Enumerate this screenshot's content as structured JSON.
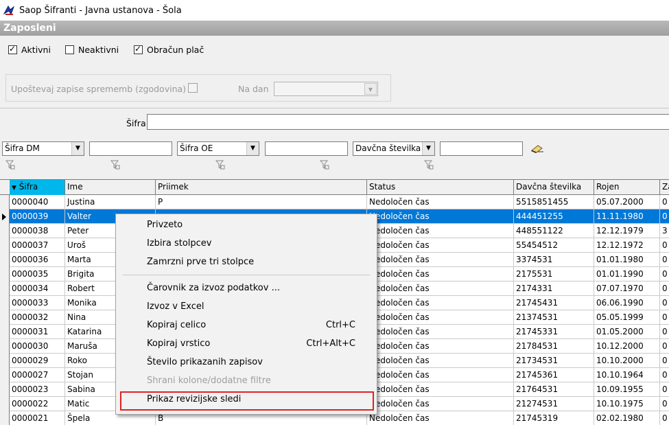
{
  "window": {
    "title": "Saop Šifranti - Javna ustanova - Šola"
  },
  "section": {
    "title": "Zaposleni"
  },
  "filters": {
    "aktivni": {
      "label": "Aktivni",
      "checked": true
    },
    "neaktivni": {
      "label": "Neaktivni",
      "checked": false
    },
    "obracun": {
      "label": "Obračun plač",
      "checked": true
    }
  },
  "history": {
    "label": "Upoštevaj zapise sprememb (zgodovina)",
    "date_label": "Na dan",
    "date_value": ""
  },
  "search": {
    "label": "Šifra",
    "value": ""
  },
  "column_filters": [
    {
      "field": "Šifra DM",
      "value": ""
    },
    {
      "field": "Šifra OE",
      "value": ""
    },
    {
      "field": "Davčna številka",
      "value": ""
    }
  ],
  "table": {
    "columns": [
      "Šifra",
      "Ime",
      "Priimek",
      "Status",
      "Davčna številka",
      "Rojen",
      "Za"
    ],
    "rows": [
      [
        "0000040",
        "Justina",
        "P",
        "Nedoločen čas",
        "5515851455",
        "05.07.2000",
        "0"
      ],
      [
        "0000039",
        "Valter",
        "",
        "Nedoločen čas",
        "444451255",
        "11.11.1980",
        "0"
      ],
      [
        "0000038",
        "Peter",
        "",
        "Nedoločen čas",
        "448551122",
        "12.12.1979",
        "3"
      ],
      [
        "0000037",
        "Uroš",
        "",
        "Nedoločen čas",
        "55454512",
        "12.12.1972",
        "0"
      ],
      [
        "0000036",
        "Marta",
        "",
        "Nedoločen čas",
        "3374531",
        "01.01.1980",
        "0"
      ],
      [
        "0000035",
        "Brigita",
        "",
        "Nedoločen čas",
        "2175531",
        "01.01.1990",
        "0"
      ],
      [
        "0000034",
        "Robert",
        "",
        "Nedoločen čas",
        "2174331",
        "07.07.1970",
        "0"
      ],
      [
        "0000033",
        "Monika",
        "",
        "Nedoločen čas",
        "21745431",
        "06.06.1990",
        "0"
      ],
      [
        "0000032",
        "Nina",
        "",
        "Nedoločen čas",
        "21374531",
        "05.05.1999",
        "0"
      ],
      [
        "0000031",
        "Katarina",
        "",
        "Nedoločen čas",
        "21745331",
        "01.05.2000",
        "0"
      ],
      [
        "0000030",
        "Maruša",
        "",
        "Nedoločen čas",
        "21784531",
        "10.12.2000",
        "0"
      ],
      [
        "0000029",
        "Roko",
        "",
        "Nedoločen čas",
        "21734531",
        "10.10.2000",
        "0"
      ],
      [
        "0000027",
        "Stojan",
        "",
        "Nedoločen čas",
        "21745361",
        "10.10.1964",
        "0"
      ],
      [
        "0000023",
        "Sabina",
        "",
        "Nedoločen čas",
        "21764531",
        "10.09.1955",
        "0"
      ],
      [
        "0000022",
        "Matic",
        "",
        "Nedoločen čas",
        "21274531",
        "10.10.1975",
        "0"
      ],
      [
        "0000021",
        "Špela",
        "B",
        "Nedoločen čas",
        "21745319",
        "02.02.1980",
        "0"
      ]
    ]
  },
  "context_menu": {
    "items": [
      {
        "label": "Privzeto",
        "shortcut": ""
      },
      {
        "label": "Izbira stolpcev",
        "shortcut": ""
      },
      {
        "label": "Zamrzni prve tri stolpce",
        "shortcut": ""
      },
      {
        "label": "Čarovnik za izvoz podatkov ...",
        "shortcut": ""
      },
      {
        "label": "Izvoz v Excel",
        "shortcut": ""
      },
      {
        "label": "Kopiraj celico",
        "shortcut": "Ctrl+C"
      },
      {
        "label": "Kopiraj vrstico",
        "shortcut": "Ctrl+Alt+C"
      },
      {
        "label": "Število prikazanih zapisov",
        "shortcut": ""
      },
      {
        "label": "Shrani kolone/dodatne filtre",
        "shortcut": "",
        "disabled": true
      },
      {
        "label": "Prikaz revizijske sledi",
        "shortcut": ""
      }
    ]
  },
  "colors": {
    "selection": "#0078d7",
    "sorted_header": "#00b7eb",
    "highlight": "#e02020"
  }
}
